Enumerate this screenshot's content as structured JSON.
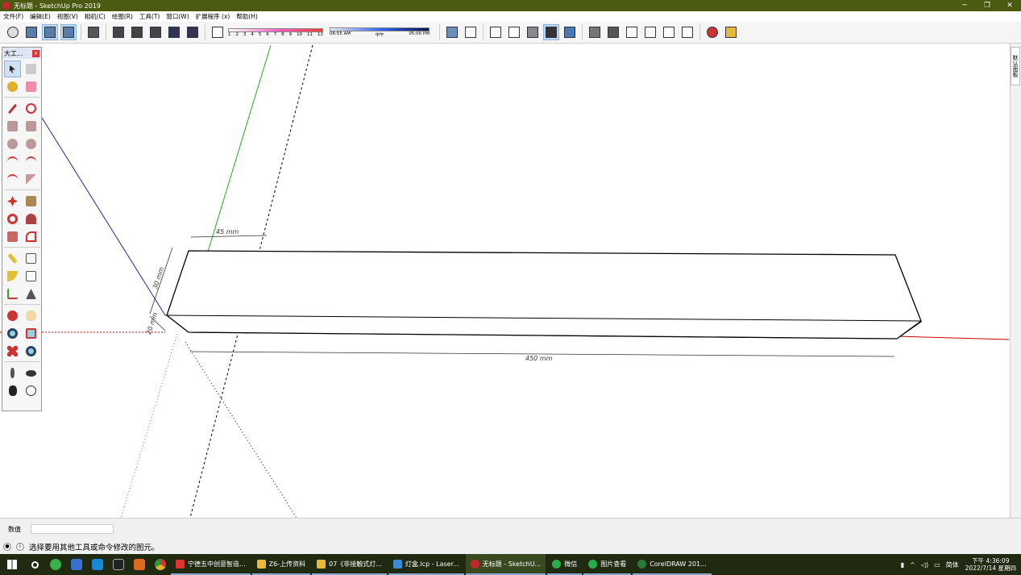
{
  "window": {
    "title": "无标题 - SketchUp Pro 2019",
    "controls": [
      "─",
      "❐",
      "✕"
    ]
  },
  "menu": [
    "文件(F)",
    "编辑(E)",
    "视图(V)",
    "相机(C)",
    "绘图(R)",
    "工具(T)",
    "窗口(W)",
    "扩展程序 (x)",
    "帮助(H)"
  ],
  "toolbar": {
    "shadow_scale": [
      "1",
      "2",
      "3",
      "4",
      "5",
      "6",
      "7",
      "8",
      "9",
      "10",
      "11",
      "12"
    ],
    "time_scale": {
      "start": "06:55 AM",
      "mid": "中午",
      "end": "05:00 PM"
    }
  },
  "panel": {
    "title": "大工...",
    "close": "x"
  },
  "right_tray": {
    "label": "默认面板"
  },
  "model": {
    "dimensions": {
      "width": "45 mm",
      "height": "30 mm",
      "depth": "20 mm",
      "length": "450 mm"
    },
    "colors": {
      "edges": "#000000",
      "face_bottom": "#e0e0e0",
      "axis_red": "#cc0000",
      "axis_green": "#22aa22",
      "axis_blue": "#2222aa"
    }
  },
  "measurements": {
    "label": "数值",
    "value": ""
  },
  "status": {
    "text": "选择要用其他工具或命令修改的图元。"
  },
  "taskbar": {
    "tasks": [
      {
        "label": "宁德五中创意智造...",
        "color": "#d33"
      },
      {
        "label": "Z6-上传资料",
        "color": "#e8b83a"
      },
      {
        "label": "07《非接触式灯...",
        "color": "#e8b83a"
      },
      {
        "label": "灯盒.lcp - Laser...",
        "color": "#3a8ad0"
      },
      {
        "label": "无标题 - SketchU...",
        "color": "#c0282d"
      },
      {
        "label": "微信",
        "color": "#2aae4a"
      },
      {
        "label": "图片查看",
        "color": "#2aae4a"
      },
      {
        "label": "CorelDRAW 201...",
        "color": "#2a7a3a"
      }
    ],
    "tray": {
      "ime": "简体",
      "time": "下午 4:36:09",
      "date": "2022/7/14 星期四"
    }
  }
}
